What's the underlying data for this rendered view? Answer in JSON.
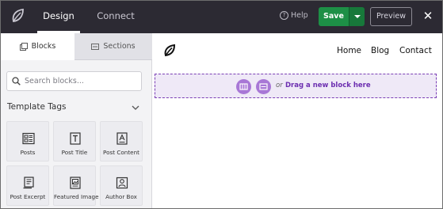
{
  "header": {
    "tabs": [
      {
        "label": "Design",
        "active": true
      },
      {
        "label": "Connect",
        "active": false
      }
    ],
    "help_label": "Help",
    "save_label": "Save",
    "preview_label": "Preview",
    "close_icon": "close-icon",
    "colors": {
      "bar": "#2c2a33",
      "save": "#1d8f46"
    }
  },
  "sidebar": {
    "tabs": [
      {
        "label": "Blocks",
        "active": true
      },
      {
        "label": "Sections",
        "active": false
      }
    ],
    "search": {
      "placeholder": "Search blocks..."
    },
    "section_title": "Template Tags",
    "blocks": [
      {
        "label": "Posts",
        "icon": "posts-icon"
      },
      {
        "label": "Post Title",
        "icon": "post-title-icon"
      },
      {
        "label": "Post Content",
        "icon": "post-content-icon"
      },
      {
        "label": "Post Excerpt",
        "icon": "post-excerpt-icon"
      },
      {
        "label": "Featured Image",
        "icon": "featured-image-icon"
      },
      {
        "label": "Author Box",
        "icon": "author-box-icon"
      }
    ]
  },
  "canvas": {
    "nav": [
      {
        "label": "Home"
      },
      {
        "label": "Blog"
      },
      {
        "label": "Contact"
      }
    ],
    "drop_zone": {
      "or_label": "or",
      "drag_label": "Drag a new block here",
      "accent": "#7b3fb5"
    }
  }
}
